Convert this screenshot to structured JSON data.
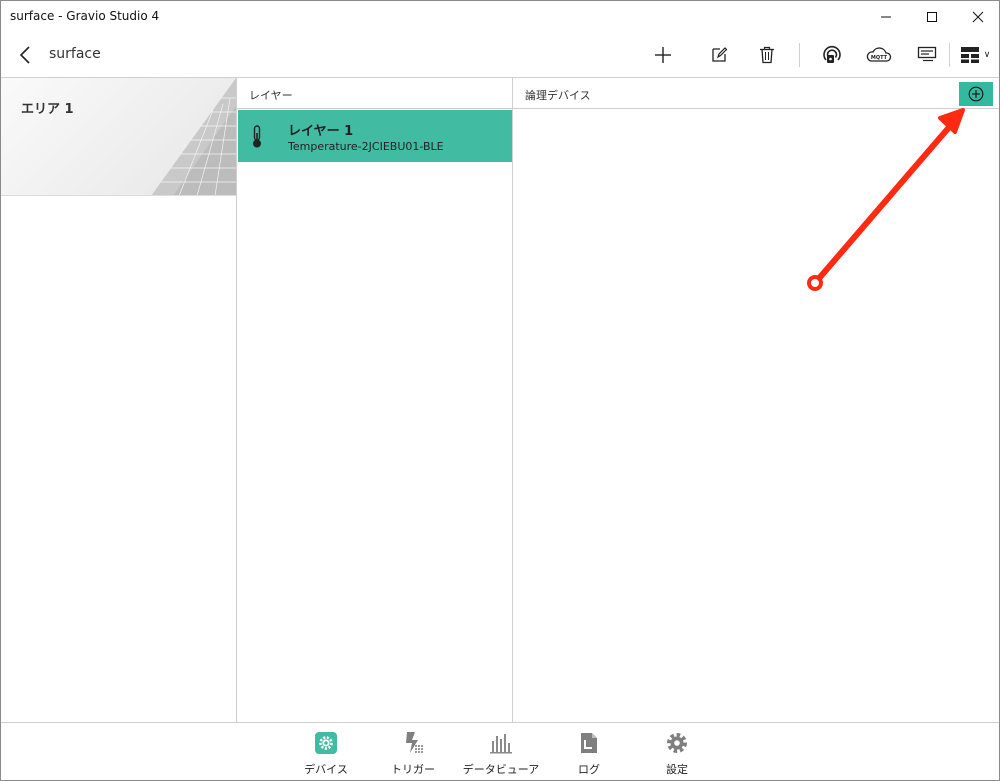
{
  "window": {
    "title": "surface - Gravio Studio 4"
  },
  "header": {
    "project_name": "surface",
    "toolbar_icons": [
      "plus-icon",
      "edit-icon",
      "trash-icon",
      "sensor-icon",
      "mqtt-icon",
      "list-icon",
      "layout-icon"
    ],
    "mqtt_text": "MQTT",
    "dropdown_glyph": "∨"
  },
  "area_pane": {
    "items": [
      {
        "label": "エリア 1"
      }
    ]
  },
  "layer_pane": {
    "header": "レイヤー",
    "items": [
      {
        "title": "レイヤー 1",
        "subtitle": "Temperature-2JCIEBU01-BLE",
        "icon": "thermometer-icon",
        "selected": true
      }
    ]
  },
  "logic_pane": {
    "header": "論理デバイス",
    "add_icon": "plus-circle-icon"
  },
  "bottom_nav": {
    "items": [
      {
        "label": "デバイス",
        "icon": "gear-badge-icon",
        "active": true
      },
      {
        "label": "トリガー",
        "icon": "trigger-icon",
        "active": false
      },
      {
        "label": "データビューア",
        "icon": "bar-chart-icon",
        "active": false
      },
      {
        "label": "ログ",
        "icon": "log-document-icon",
        "active": false
      },
      {
        "label": "設定",
        "icon": "settings-gear-icon",
        "active": false
      }
    ]
  },
  "colors": {
    "accent": "#41bba2",
    "annotation": "#ff2a12",
    "icon_gray": "#7f7f7f"
  }
}
